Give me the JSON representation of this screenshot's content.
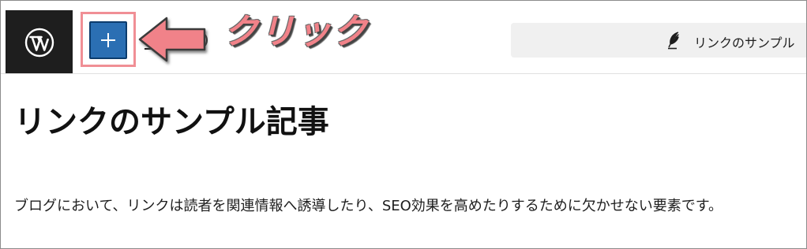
{
  "topbar": {
    "logo_icon": "wordpress-logo-icon",
    "inserter_icon": "plus-icon",
    "inserter_label": "",
    "annotation_text": "クリック",
    "annotation_color": "#f18289",
    "highlight_color": "#f08f95",
    "accent_color": "#2b6fb3"
  },
  "document_bar": {
    "icon": "feather-icon",
    "title": "リンクのサンプル"
  },
  "post": {
    "title": "リンクのサンプル記事",
    "paragraph": "ブログにおいて、リンクは読者を関連情報へ誘導したり、SEO効果を高めたりするために欠かせない要素です。"
  }
}
